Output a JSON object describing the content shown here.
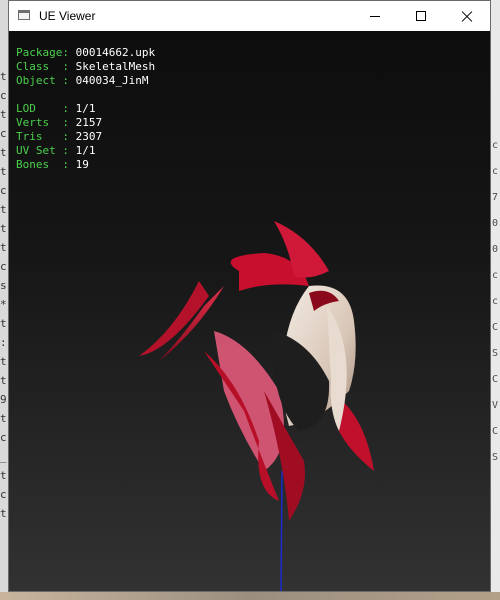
{
  "window": {
    "title": "UE Viewer"
  },
  "info": {
    "package_label": "Package: ",
    "package": "00014662.upk",
    "class_label": "Class  : ",
    "class": "SkeletalMesh",
    "object_label": "Object : ",
    "object": "040034_JinM",
    "lod_label": "LOD    : ",
    "lod": "1/1",
    "verts_label": "Verts  : ",
    "verts": "2157",
    "tris_label": "Tris   : ",
    "tris": "2307",
    "uvset_label": "UV Set : ",
    "uvset": "1/1",
    "bones_label": "Bones  : ",
    "bones": "19"
  },
  "background": {
    "left_glyphs": [
      "t",
      "c",
      "t",
      "c",
      "t",
      "t",
      "c",
      "t",
      "t",
      "t",
      "c",
      "s",
      "*",
      "t",
      ":",
      "t",
      "t",
      "9",
      "t",
      "c",
      "_",
      "t",
      "c",
      "t"
    ],
    "right_glyphs": [
      "c",
      "c",
      "7",
      "0",
      "0",
      "c",
      "c",
      "C",
      "S",
      "C",
      "V",
      "C",
      "S"
    ]
  },
  "icons": [
    "app-icon",
    "minimize-icon",
    "maximize-icon",
    "close-icon"
  ],
  "colors": {
    "label": "#4cd04c",
    "value": "#ffffff",
    "feather": "#c8102e",
    "mask": "#e8dcd0"
  }
}
